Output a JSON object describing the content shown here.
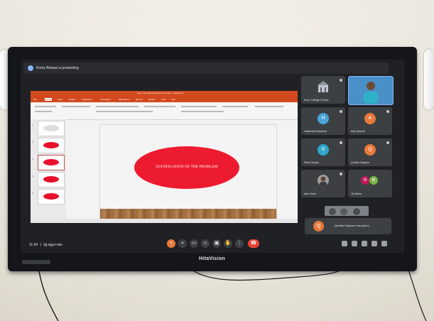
{
  "meeting": {
    "presenting": "Komy Biswas is presenting",
    "clock": "11:34",
    "code": "tyj-sgyv-xav"
  },
  "ppt": {
    "title": "How to Prepare Research Proposal - PowerPoint",
    "tabs": [
      "File",
      "Home",
      "Insert",
      "Design",
      "Transitions",
      "Animations",
      "Slide Show",
      "Record",
      "Review",
      "View",
      "Help"
    ],
    "slide_text": "JUSTIFICATION OF THE PROBLEM",
    "thumb_numbers": [
      "1",
      "2",
      "3",
      "4",
      "5"
    ]
  },
  "participants": [
    {
      "initial": "",
      "name": "Govt. College Of Edu...",
      "color": "#3c4043"
    },
    {
      "initial": "",
      "name": "",
      "color": "#4a90c8"
    },
    {
      "initial": "H",
      "name": "Hafsa Bint Rasheed",
      "color": "#4aa3d8"
    },
    {
      "initial": "A",
      "name": "Adil Qureshi",
      "color": "#e8793b"
    },
    {
      "initial": "S",
      "name": "Shah Gousia",
      "color": "#2ea6c9"
    },
    {
      "initial": "Q",
      "name": "Qurtiba Gayoom",
      "color": "#e8793b"
    },
    {
      "initial": "",
      "name": "Amir Nazir",
      "color": "#3c4043"
    },
    {
      "initial": "N",
      "name": "18 others",
      "color": "#7cb342"
    }
  ],
  "notification": {
    "initial": "Q",
    "text": "Qurtiba Gayoom has joined"
  },
  "tv_brand": "HitaVision",
  "colors": {
    "ppt_accent": "#d2491e",
    "oval": "#ed1b2f",
    "end_call": "#ea4335",
    "meet_bg": "#202124"
  }
}
